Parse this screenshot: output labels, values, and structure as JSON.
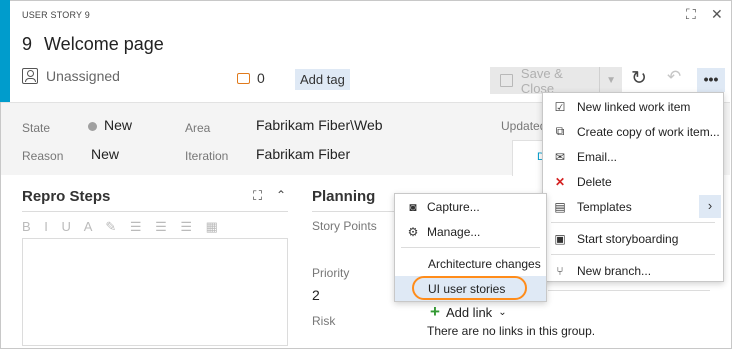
{
  "header": {
    "work_item_type": "USER STORY 9",
    "id": "9",
    "title": "Welcome page",
    "assignee": "Unassigned",
    "comment_count": "0",
    "add_tag_label": "Add tag",
    "save_close_label": "Save & Close",
    "more_actions_label": "•••",
    "expand_icon_glyph": "⛶",
    "close_icon_glyph": "✕"
  },
  "fields": {
    "state_label": "State",
    "state_value": "New",
    "reason_label": "Reason",
    "reason_value": "New",
    "area_label": "Area",
    "area_value": "Fabrikam Fiber\\Web",
    "iteration_label": "Iteration",
    "iteration_value": "Fabrikam Fiber",
    "updated_label": "Updated",
    "tab_fragment": "D"
  },
  "repro_steps": {
    "heading": "Repro Steps",
    "toolbar_glyphs": "B I U A ✎ ☰ ☰ ☰ ▦"
  },
  "planning": {
    "heading": "Planning",
    "story_points_label": "Story Points",
    "priority_label": "Priority",
    "priority_value": "2",
    "risk_label": "Risk"
  },
  "links": {
    "add_link_label": "Add link",
    "empty_text": "There are no links in this group."
  },
  "templates_submenu": {
    "items": [
      {
        "icon": "capture-icon",
        "label": "Capture..."
      },
      {
        "icon": "manage-gear-icon",
        "label": "Manage..."
      },
      {
        "label": "Architecture changes"
      },
      {
        "label": "UI user stories"
      }
    ]
  },
  "actions_menu": {
    "items": [
      {
        "icon": "new-linked-work-item-icon",
        "label": "New linked work item"
      },
      {
        "icon": "copy-icon",
        "label": "Create copy of work item..."
      },
      {
        "icon": "email-icon",
        "label": "Email..."
      },
      {
        "icon": "delete-icon",
        "label": "Delete"
      },
      {
        "icon": "templates-icon",
        "label": "Templates"
      },
      {
        "icon": "storyboard-icon",
        "label": "Start storyboarding"
      },
      {
        "icon": "branch-icon",
        "label": "New branch..."
      }
    ]
  },
  "colors": {
    "accent": "#009ccc",
    "highlight": "#dfe9f5",
    "callout_orange": "#ff8c1a",
    "delete_red": "#d42020"
  }
}
